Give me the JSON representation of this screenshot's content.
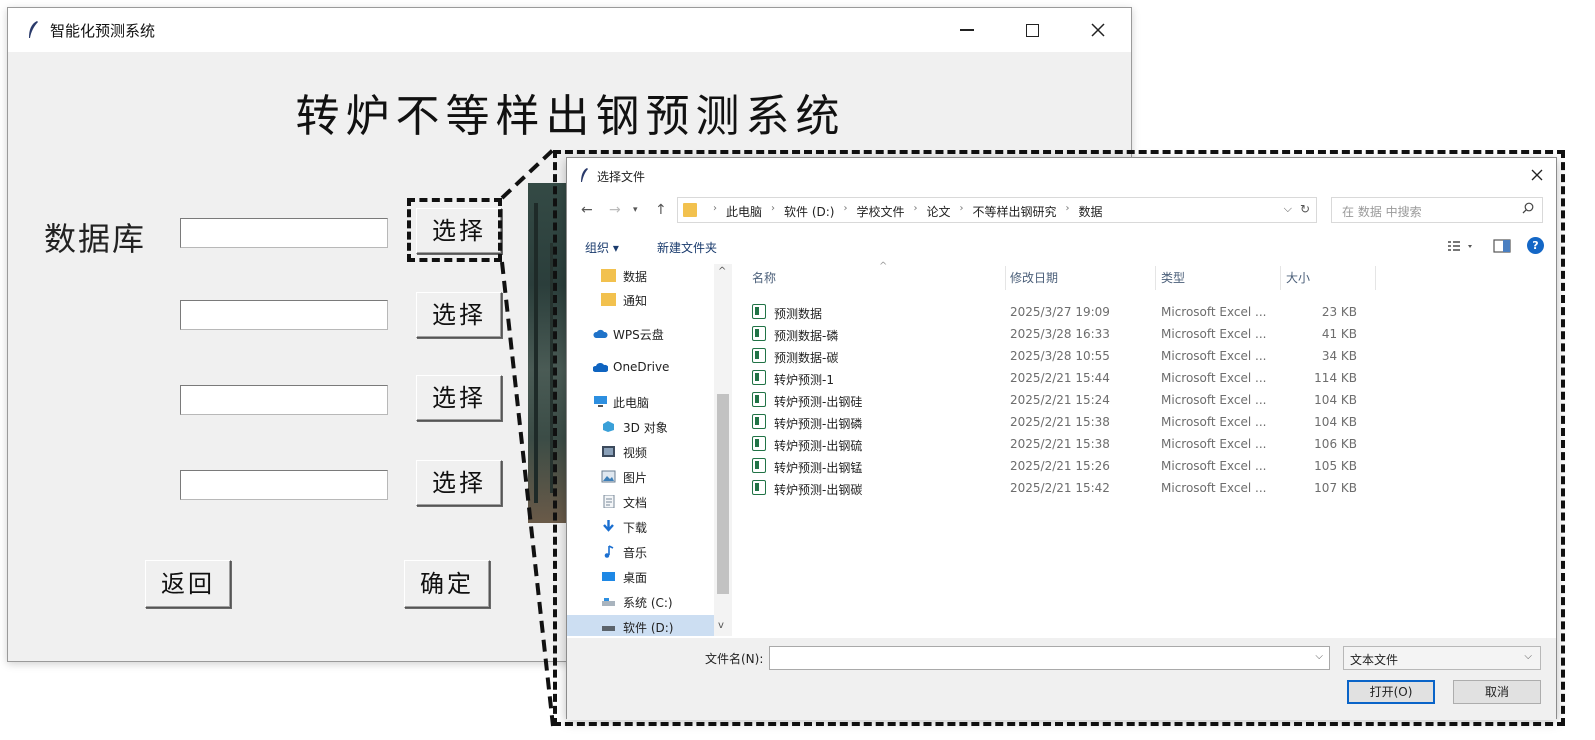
{
  "main_window": {
    "title": "智能化预测系统",
    "heading": "转炉不等样出钢预测系统",
    "db_label": "数据库",
    "select_buttons": [
      "选择",
      "选择",
      "选择",
      "选择"
    ],
    "back_label": "返回",
    "confirm_label": "确定"
  },
  "dialog": {
    "title": "选择文件",
    "breadcrumbs": [
      "此电脑",
      "软件 (D:)",
      "学校文件",
      "论文",
      "不等样出钢研究",
      "数据"
    ],
    "search_placeholder": "在 数据 中搜索",
    "organize_label": "组织 ▾",
    "new_folder_label": "新建文件夹",
    "help_label": "?",
    "nav_items": [
      {
        "label": "数据",
        "icon": "folder-icon"
      },
      {
        "label": "通知",
        "icon": "folder-icon"
      },
      {
        "label": "WPS云盘",
        "icon": "cloud-icon"
      },
      {
        "label": "OneDrive",
        "icon": "cloud-icon"
      },
      {
        "label": "此电脑",
        "icon": "computer-icon"
      },
      {
        "label": "3D 对象",
        "icon": "cube-icon"
      },
      {
        "label": "视频",
        "icon": "video-icon"
      },
      {
        "label": "图片",
        "icon": "picture-icon"
      },
      {
        "label": "文档",
        "icon": "document-icon"
      },
      {
        "label": "下载",
        "icon": "download-icon"
      },
      {
        "label": "音乐",
        "icon": "music-icon"
      },
      {
        "label": "桌面",
        "icon": "desktop-icon"
      },
      {
        "label": "系统 (C:)",
        "icon": "drive-icon"
      },
      {
        "label": "软件 (D:)",
        "icon": "drive-icon"
      }
    ],
    "columns": {
      "name": "名称",
      "date": "修改日期",
      "type": "类型",
      "size": "大小"
    },
    "files": [
      {
        "name": "预测数据",
        "date": "2025/3/27 19:09",
        "type": "Microsoft Excel ...",
        "size": "23 KB"
      },
      {
        "name": "预测数据-磷",
        "date": "2025/3/28 16:33",
        "type": "Microsoft Excel ...",
        "size": "41 KB"
      },
      {
        "name": "预测数据-碳",
        "date": "2025/3/28 10:55",
        "type": "Microsoft Excel ...",
        "size": "34 KB"
      },
      {
        "name": "转炉预测-1",
        "date": "2025/2/21 15:44",
        "type": "Microsoft Excel ...",
        "size": "114 KB"
      },
      {
        "name": "转炉预测-出钢硅",
        "date": "2025/2/21 15:24",
        "type": "Microsoft Excel ...",
        "size": "104 KB"
      },
      {
        "name": "转炉预测-出钢磷",
        "date": "2025/2/21 15:38",
        "type": "Microsoft Excel ...",
        "size": "104 KB"
      },
      {
        "name": "转炉预测-出钢硫",
        "date": "2025/2/21 15:38",
        "type": "Microsoft Excel ...",
        "size": "106 KB"
      },
      {
        "name": "转炉预测-出钢锰",
        "date": "2025/2/21 15:26",
        "type": "Microsoft Excel ...",
        "size": "105 KB"
      },
      {
        "name": "转炉预测-出钢碳",
        "date": "2025/2/21 15:42",
        "type": "Microsoft Excel ...",
        "size": "107 KB"
      }
    ],
    "filename_label": "文件名(N):",
    "filename_value": "",
    "filetype_value": "文本文件",
    "open_label": "打开(O)",
    "cancel_label": "取消"
  },
  "colors": {
    "accent": "#0a64c8",
    "excel": "#217346",
    "folder": "#f2c14e",
    "selected": "#ccdef2"
  }
}
